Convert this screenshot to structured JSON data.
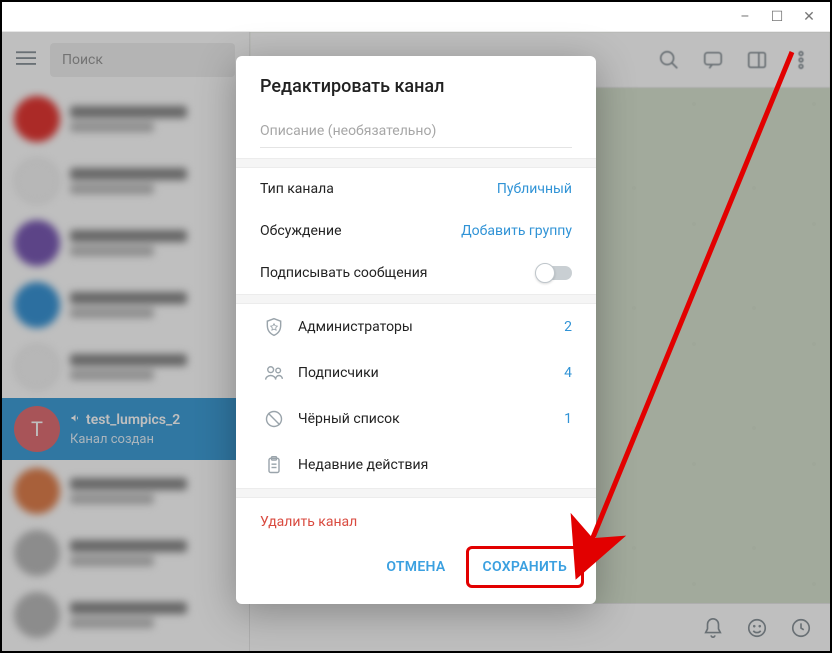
{
  "window": {
    "minimize": "–",
    "maximize": "☐",
    "close": "✕"
  },
  "search": {
    "placeholder": "Поиск"
  },
  "active_chat": {
    "avatar_letter": "T",
    "name": "test_lumpics_2",
    "subtitle": "Канал создан"
  },
  "dialog": {
    "title": "Редактировать канал",
    "desc_placeholder": "Описание (необязательно)",
    "rows": {
      "type": {
        "label": "Тип канала",
        "value": "Публичный"
      },
      "discussion": {
        "label": "Обсуждение",
        "value": "Добавить группу"
      },
      "sign": {
        "label": "Подписывать сообщения"
      }
    },
    "mgmt": {
      "admins": {
        "label": "Администраторы",
        "count": "2"
      },
      "subs": {
        "label": "Подписчики",
        "count": "4"
      },
      "black": {
        "label": "Чёрный список",
        "count": "1"
      },
      "recent": {
        "label": "Недавние действия"
      }
    },
    "delete": "Удалить канал",
    "cancel": "ОТМЕНА",
    "save": "СОХРАНИТЬ"
  }
}
